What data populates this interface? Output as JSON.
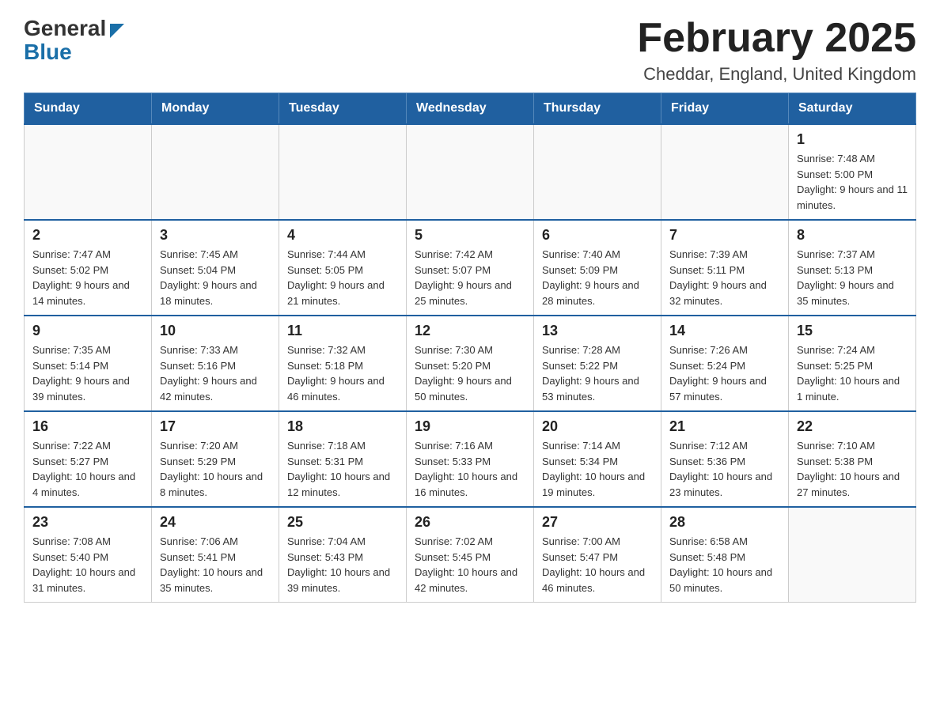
{
  "header": {
    "logo_general": "General",
    "logo_blue": "Blue",
    "month_title": "February 2025",
    "location": "Cheddar, England, United Kingdom"
  },
  "days_of_week": [
    "Sunday",
    "Monday",
    "Tuesday",
    "Wednesday",
    "Thursday",
    "Friday",
    "Saturday"
  ],
  "weeks": [
    [
      {
        "day": "",
        "info": ""
      },
      {
        "day": "",
        "info": ""
      },
      {
        "day": "",
        "info": ""
      },
      {
        "day": "",
        "info": ""
      },
      {
        "day": "",
        "info": ""
      },
      {
        "day": "",
        "info": ""
      },
      {
        "day": "1",
        "info": "Sunrise: 7:48 AM\nSunset: 5:00 PM\nDaylight: 9 hours and 11 minutes."
      }
    ],
    [
      {
        "day": "2",
        "info": "Sunrise: 7:47 AM\nSunset: 5:02 PM\nDaylight: 9 hours and 14 minutes."
      },
      {
        "day": "3",
        "info": "Sunrise: 7:45 AM\nSunset: 5:04 PM\nDaylight: 9 hours and 18 minutes."
      },
      {
        "day": "4",
        "info": "Sunrise: 7:44 AM\nSunset: 5:05 PM\nDaylight: 9 hours and 21 minutes."
      },
      {
        "day": "5",
        "info": "Sunrise: 7:42 AM\nSunset: 5:07 PM\nDaylight: 9 hours and 25 minutes."
      },
      {
        "day": "6",
        "info": "Sunrise: 7:40 AM\nSunset: 5:09 PM\nDaylight: 9 hours and 28 minutes."
      },
      {
        "day": "7",
        "info": "Sunrise: 7:39 AM\nSunset: 5:11 PM\nDaylight: 9 hours and 32 minutes."
      },
      {
        "day": "8",
        "info": "Sunrise: 7:37 AM\nSunset: 5:13 PM\nDaylight: 9 hours and 35 minutes."
      }
    ],
    [
      {
        "day": "9",
        "info": "Sunrise: 7:35 AM\nSunset: 5:14 PM\nDaylight: 9 hours and 39 minutes."
      },
      {
        "day": "10",
        "info": "Sunrise: 7:33 AM\nSunset: 5:16 PM\nDaylight: 9 hours and 42 minutes."
      },
      {
        "day": "11",
        "info": "Sunrise: 7:32 AM\nSunset: 5:18 PM\nDaylight: 9 hours and 46 minutes."
      },
      {
        "day": "12",
        "info": "Sunrise: 7:30 AM\nSunset: 5:20 PM\nDaylight: 9 hours and 50 minutes."
      },
      {
        "day": "13",
        "info": "Sunrise: 7:28 AM\nSunset: 5:22 PM\nDaylight: 9 hours and 53 minutes."
      },
      {
        "day": "14",
        "info": "Sunrise: 7:26 AM\nSunset: 5:24 PM\nDaylight: 9 hours and 57 minutes."
      },
      {
        "day": "15",
        "info": "Sunrise: 7:24 AM\nSunset: 5:25 PM\nDaylight: 10 hours and 1 minute."
      }
    ],
    [
      {
        "day": "16",
        "info": "Sunrise: 7:22 AM\nSunset: 5:27 PM\nDaylight: 10 hours and 4 minutes."
      },
      {
        "day": "17",
        "info": "Sunrise: 7:20 AM\nSunset: 5:29 PM\nDaylight: 10 hours and 8 minutes."
      },
      {
        "day": "18",
        "info": "Sunrise: 7:18 AM\nSunset: 5:31 PM\nDaylight: 10 hours and 12 minutes."
      },
      {
        "day": "19",
        "info": "Sunrise: 7:16 AM\nSunset: 5:33 PM\nDaylight: 10 hours and 16 minutes."
      },
      {
        "day": "20",
        "info": "Sunrise: 7:14 AM\nSunset: 5:34 PM\nDaylight: 10 hours and 19 minutes."
      },
      {
        "day": "21",
        "info": "Sunrise: 7:12 AM\nSunset: 5:36 PM\nDaylight: 10 hours and 23 minutes."
      },
      {
        "day": "22",
        "info": "Sunrise: 7:10 AM\nSunset: 5:38 PM\nDaylight: 10 hours and 27 minutes."
      }
    ],
    [
      {
        "day": "23",
        "info": "Sunrise: 7:08 AM\nSunset: 5:40 PM\nDaylight: 10 hours and 31 minutes."
      },
      {
        "day": "24",
        "info": "Sunrise: 7:06 AM\nSunset: 5:41 PM\nDaylight: 10 hours and 35 minutes."
      },
      {
        "day": "25",
        "info": "Sunrise: 7:04 AM\nSunset: 5:43 PM\nDaylight: 10 hours and 39 minutes."
      },
      {
        "day": "26",
        "info": "Sunrise: 7:02 AM\nSunset: 5:45 PM\nDaylight: 10 hours and 42 minutes."
      },
      {
        "day": "27",
        "info": "Sunrise: 7:00 AM\nSunset: 5:47 PM\nDaylight: 10 hours and 46 minutes."
      },
      {
        "day": "28",
        "info": "Sunrise: 6:58 AM\nSunset: 5:48 PM\nDaylight: 10 hours and 50 minutes."
      },
      {
        "day": "",
        "info": ""
      }
    ]
  ]
}
